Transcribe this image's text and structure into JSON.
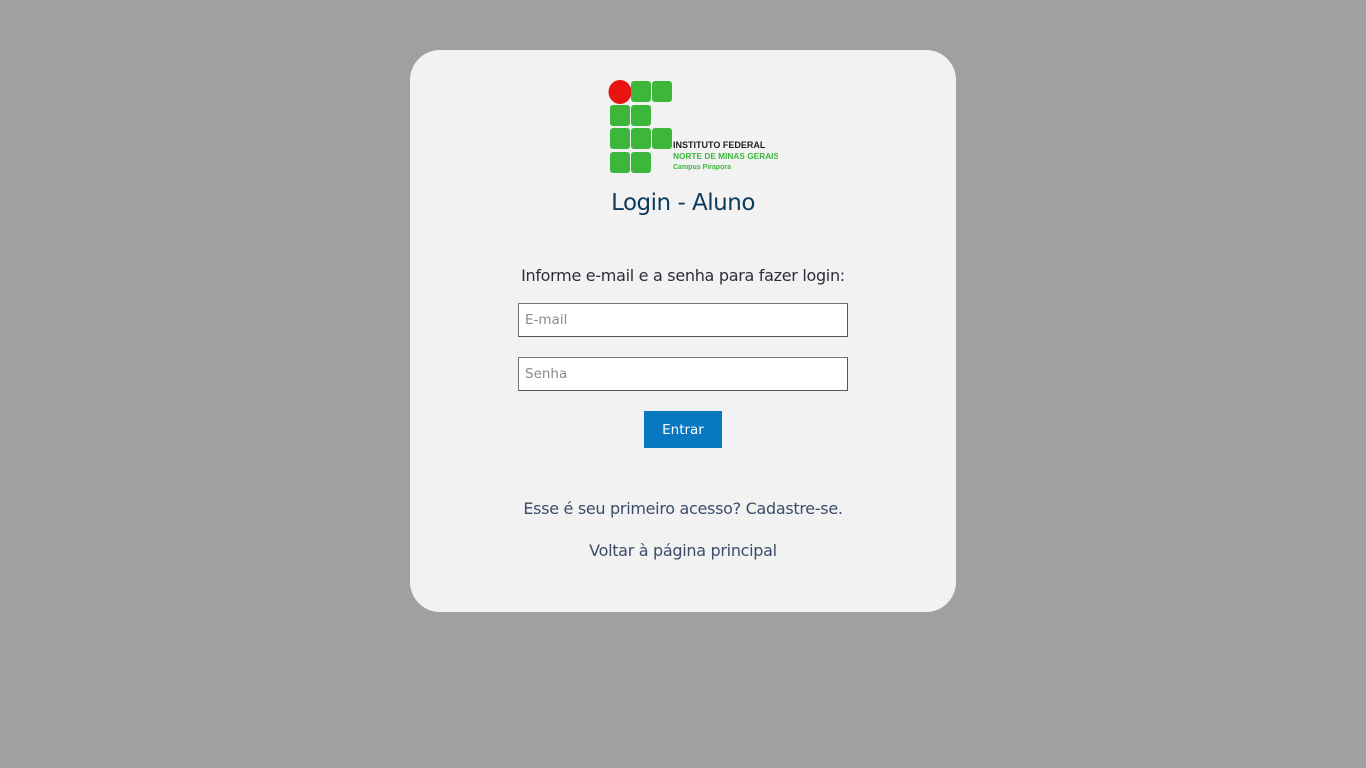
{
  "logo": {
    "line1": "INSTITUTO FEDERAL",
    "line2": "NORTE DE MINAS GERAIS",
    "line3": "Campus Pirapora",
    "colors": {
      "green": "#3cb73c",
      "red": "#e8140f",
      "text_dark": "#222222"
    }
  },
  "title": "Login - Aluno",
  "instruction": "Informe e-mail e a senha para fazer login:",
  "email": {
    "placeholder": "E-mail",
    "value": ""
  },
  "senha": {
    "placeholder": "Senha",
    "value": ""
  },
  "submit_label": "Entrar",
  "links": {
    "signup": "Esse é seu primeiro acesso? Cadastre-se.",
    "back": "Voltar à página principal"
  },
  "colors": {
    "page_bg": "#a0a0a0",
    "card_bg": "#f2f2f2",
    "title": "#0e3b5c",
    "button": "#0878c0"
  }
}
